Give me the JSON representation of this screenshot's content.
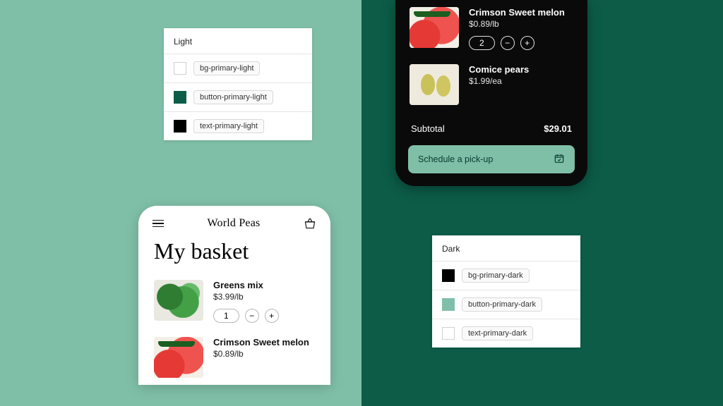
{
  "colors": {
    "bg_left": "#7fbfa8",
    "bg_right": "#0c5c48",
    "dark_bg": "#0a0a0a",
    "accent": "#7fbfa8"
  },
  "palette_light": {
    "title": "Light",
    "rows": [
      {
        "swatch": "#ffffff",
        "token": "bg-primary-light"
      },
      {
        "swatch": "#0c5c48",
        "token": "button-primary-light"
      },
      {
        "swatch": "#000000",
        "token": "text-primary-light"
      }
    ]
  },
  "palette_dark": {
    "title": "Dark",
    "rows": [
      {
        "swatch": "#000000",
        "token": "bg-primary-dark"
      },
      {
        "swatch": "#7fbfa8",
        "token": "button-primary-dark"
      },
      {
        "swatch": "#ffffff",
        "token": "text-primary-dark"
      }
    ]
  },
  "light_phone": {
    "brand": "World Peas",
    "title": "My basket",
    "items": [
      {
        "name": "Greens mix",
        "price": "$3.99/lb",
        "qty": "1"
      },
      {
        "name": "Crimson Sweet melon",
        "price": "$0.89/lb"
      }
    ]
  },
  "dark_phone": {
    "items": [
      {
        "name": "Crimson Sweet melon",
        "price": "$0.89/lb",
        "qty": "2"
      },
      {
        "name": "Comice pears",
        "price": "$1.99/ea"
      }
    ],
    "subtotal_label": "Subtotal",
    "subtotal_value": "$29.01",
    "cta": "Schedule a pick-up"
  }
}
